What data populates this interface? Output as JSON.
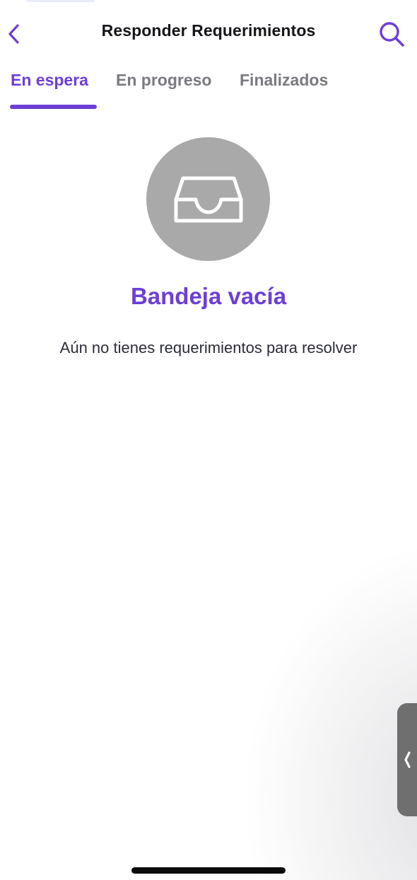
{
  "header": {
    "title": "Responder Requerimientos",
    "back_icon": "chevron-left-icon",
    "search_icon": "search-icon"
  },
  "tabs": [
    {
      "label": "En espera",
      "active": true
    },
    {
      "label": "En progreso",
      "active": false
    },
    {
      "label": "Finalizados",
      "active": false
    }
  ],
  "empty_state": {
    "icon": "inbox-tray-icon",
    "title": "Bandeja vacía",
    "description": "Aún no tienes requerimientos para resolver"
  },
  "side_handle": {
    "icon": "chevron-left-icon"
  },
  "colors": {
    "accent": "#6c3fd6",
    "tab_inactive": "#7a7a80",
    "empty_circle": "#a9a9a9",
    "handle": "#6f6f6f"
  }
}
